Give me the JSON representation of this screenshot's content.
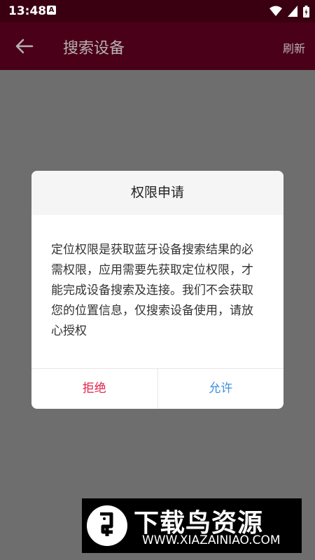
{
  "status_bar": {
    "time": "13:48",
    "notification_icon": "A"
  },
  "app_bar": {
    "title": "搜索设备",
    "refresh_label": "刷新"
  },
  "dialog": {
    "title": "权限申请",
    "message": "定位权限是获取蓝牙设备搜索结果的必需权限，应用需要先获取定位权限，才能完成设备搜索及连接。我们不会获取您的位置信息，仅搜索设备使用，请放心授权",
    "deny_label": "拒绝",
    "allow_label": "允许"
  },
  "watermark": {
    "title": "下载鸟资源",
    "url": "WWW.XIAZAINIAO.COM"
  },
  "colors": {
    "status_bar_bg": "#3a0012",
    "app_bar_bg": "#4a0018",
    "deny": "#e0234a",
    "allow": "#3b8fe0"
  }
}
